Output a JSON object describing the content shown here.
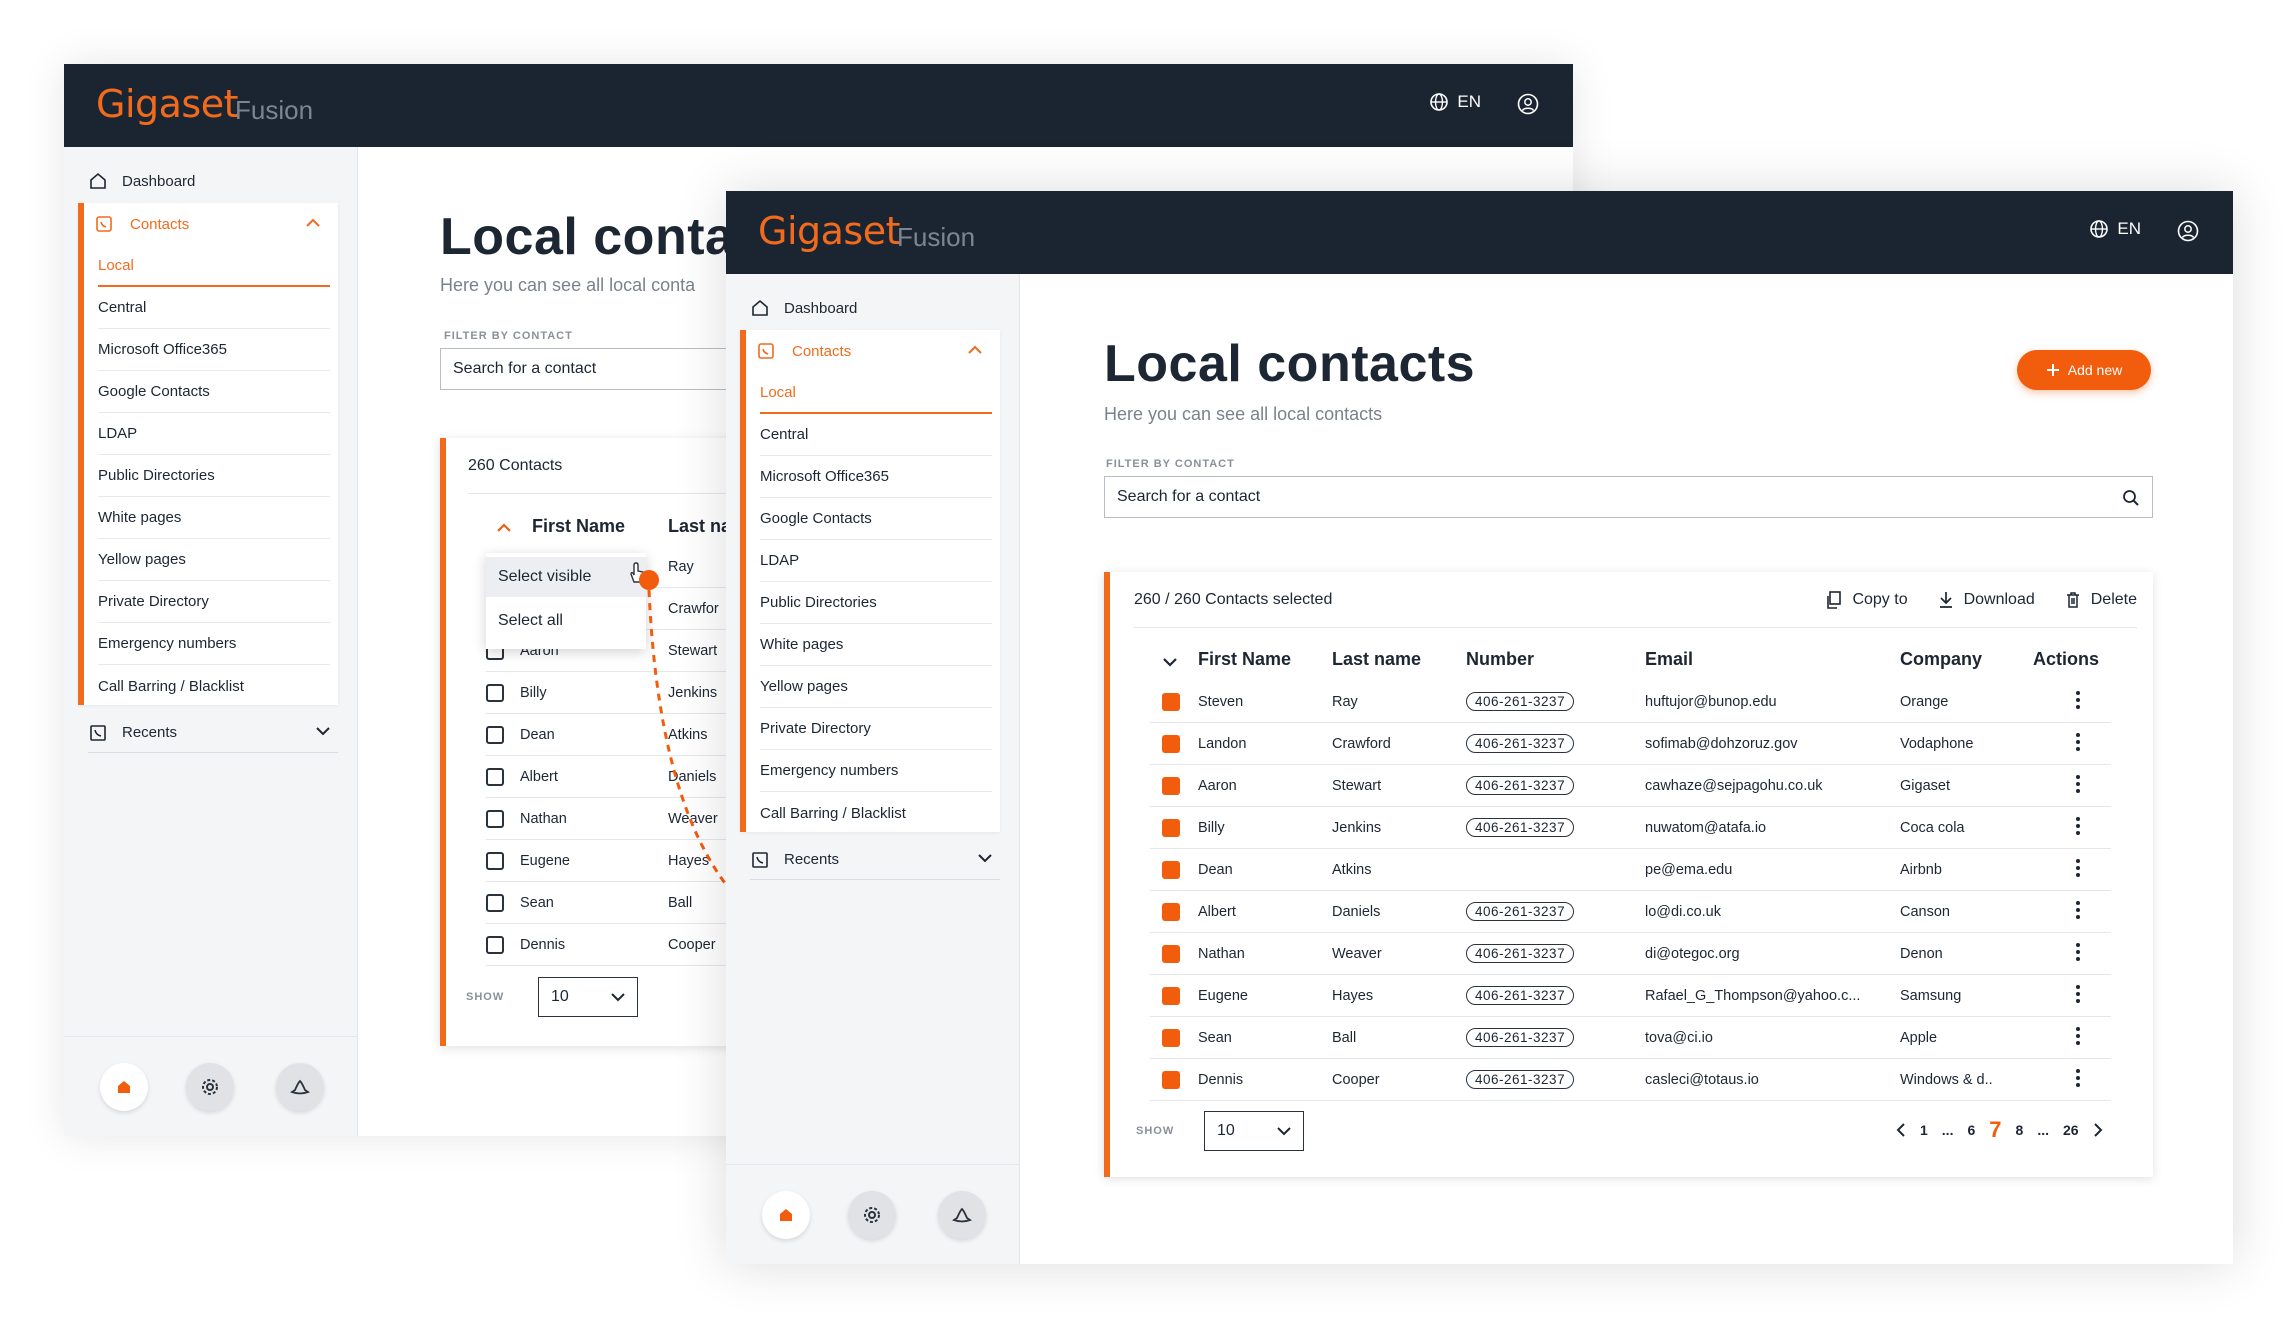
{
  "app": {
    "brand": "Gigaset",
    "product": "Fusion",
    "language": "EN"
  },
  "colors": {
    "accent": "#f25c0d",
    "topbar": "#1b2532",
    "sidebar": "#f4f5f7"
  },
  "sidebar": {
    "dashboard": "Dashboard",
    "contacts": "Contacts",
    "recents": "Recents",
    "sub_items": [
      "Local",
      "Central",
      "Microsoft Office365",
      "Google Contacts",
      "LDAP",
      "Public Directories",
      "White pages",
      "Yellow pages",
      "Private Directory",
      "Emergency numbers",
      "Call Barring / Blacklist"
    ]
  },
  "page": {
    "title": "Local contacts",
    "subtitle": "Here you can see all local contacts",
    "filter_label": "FILTER BY CONTACT",
    "search_placeholder": "Search for a contact",
    "add_new": "Add new"
  },
  "back_view": {
    "title_partial": "Local conta",
    "subtitle_partial": "Here you can see all local conta",
    "count_label": "260 Contacts",
    "header_first": "First Name",
    "header_last": "Last na",
    "dropdown": {
      "select_visible": "Select visible",
      "select_all": "Select all"
    },
    "rows": [
      {
        "first": "",
        "last": "Ray"
      },
      {
        "first": "",
        "last": "Crawfor"
      },
      {
        "first": "Aaron",
        "last": "Stewart"
      },
      {
        "first": "Billy",
        "last": "Jenkins"
      },
      {
        "first": "Dean",
        "last": "Atkins"
      },
      {
        "first": "Albert",
        "last": "Daniels"
      },
      {
        "first": "Nathan",
        "last": "Weaver"
      },
      {
        "first": "Eugene",
        "last": "Hayes"
      },
      {
        "first": "Sean",
        "last": "Ball"
      },
      {
        "first": "Dennis",
        "last": "Cooper"
      }
    ],
    "show_label": "SHOW",
    "show_value": "10"
  },
  "table": {
    "selected_label": "260 / 260 Contacts selected",
    "toolbar": {
      "copy": "Copy to",
      "download": "Download",
      "delete": "Delete"
    },
    "headers": {
      "first": "First Name",
      "last": "Last name",
      "number": "Number",
      "email": "Email",
      "company": "Company",
      "actions": "Actions"
    },
    "rows": [
      {
        "first": "Steven",
        "last": "Ray",
        "number": "406-261-3237",
        "email": "huftujor@bunop.edu",
        "company": "Orange"
      },
      {
        "first": "Landon",
        "last": "Crawford",
        "number": "406-261-3237",
        "email": "sofimab@dohzoruz.gov",
        "company": "Vodaphone"
      },
      {
        "first": "Aaron",
        "last": "Stewart",
        "number": "406-261-3237",
        "email": "cawhaze@sejpagohu.co.uk",
        "company": "Gigaset"
      },
      {
        "first": "Billy",
        "last": "Jenkins",
        "number": "406-261-3237",
        "email": "nuwatom@atafa.io",
        "company": "Coca cola"
      },
      {
        "first": "Dean",
        "last": "Atkins",
        "number": "",
        "email": "pe@ema.edu",
        "company": "Airbnb"
      },
      {
        "first": "Albert",
        "last": "Daniels",
        "number": "406-261-3237",
        "email": "lo@di.co.uk",
        "company": "Canson"
      },
      {
        "first": "Nathan",
        "last": "Weaver",
        "number": "406-261-3237",
        "email": "di@otegoc.org",
        "company": "Denon"
      },
      {
        "first": "Eugene",
        "last": "Hayes",
        "number": "406-261-3237",
        "email": "Rafael_G_Thompson@yahoo.c...",
        "company": "Samsung"
      },
      {
        "first": "Sean",
        "last": "Ball",
        "number": "406-261-3237",
        "email": "tova@ci.io",
        "company": "Apple"
      },
      {
        "first": "Dennis",
        "last": "Cooper",
        "number": "406-261-3237",
        "email": "casleci@totaus.io",
        "company": "Windows & d.."
      }
    ],
    "show_label": "SHOW",
    "show_value": "10",
    "pagination": {
      "p1": "1",
      "e1": "...",
      "p6": "6",
      "current": "7",
      "p8": "8",
      "e2": "...",
      "last": "26"
    }
  }
}
